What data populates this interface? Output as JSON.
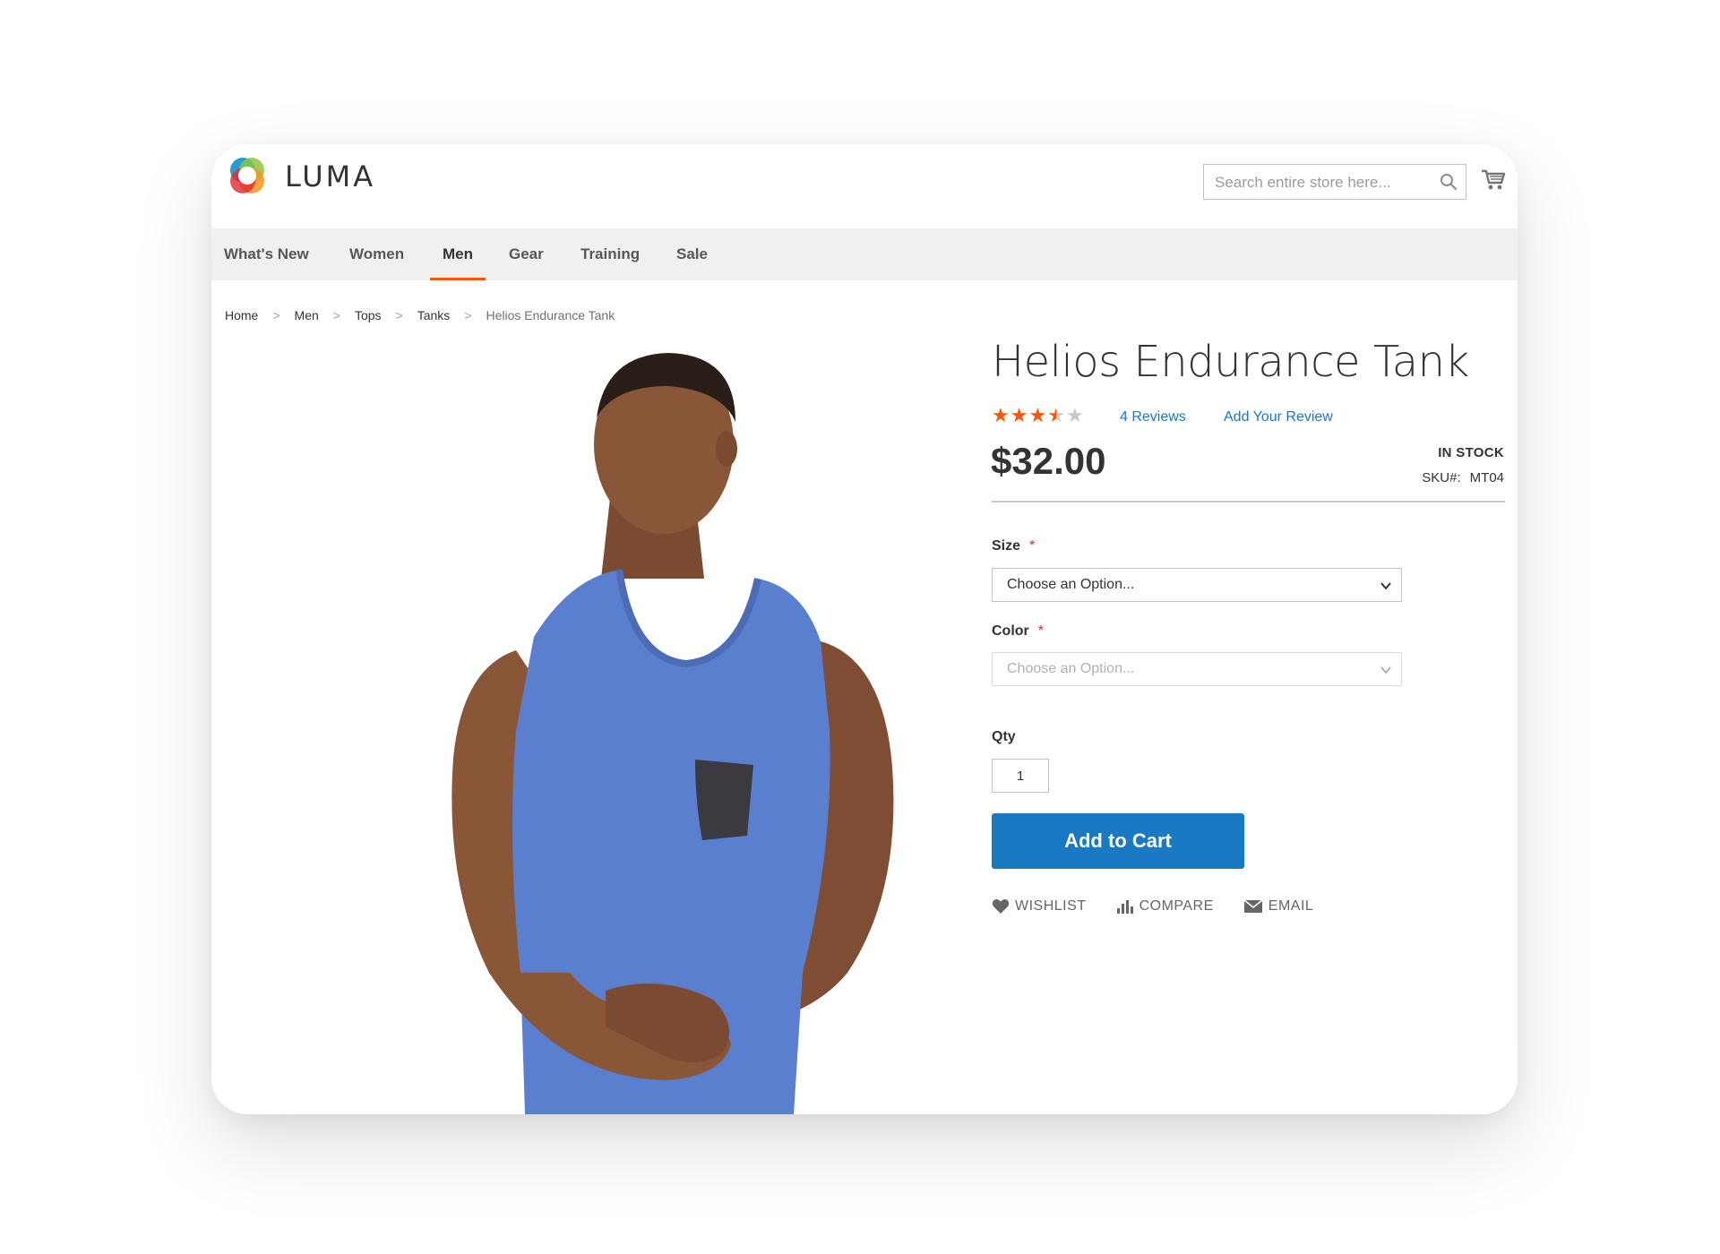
{
  "brand": {
    "name": "LUMA"
  },
  "search": {
    "placeholder": "Search entire store here..."
  },
  "nav": {
    "items": [
      {
        "label": "What's New",
        "active": false
      },
      {
        "label": "Women",
        "active": false
      },
      {
        "label": "Men",
        "active": true
      },
      {
        "label": "Gear",
        "active": false
      },
      {
        "label": "Training",
        "active": false
      },
      {
        "label": "Sale",
        "active": false
      }
    ]
  },
  "breadcrumb": {
    "items": [
      "Home",
      "Men",
      "Tops",
      "Tanks",
      "Helios Endurance Tank"
    ],
    "separator": ">"
  },
  "product": {
    "title": "Helios Endurance Tank",
    "rating": {
      "filled": 3.5,
      "max": 5
    },
    "reviews_link": "4 Reviews",
    "add_review_link": "Add Your Review",
    "price": "$32.00",
    "stock": "IN STOCK",
    "sku_label": "SKU#:",
    "sku": "MT04"
  },
  "options": {
    "size": {
      "label": "Size",
      "required_mark": "*",
      "value": "Choose an Option..."
    },
    "color": {
      "label": "Color",
      "required_mark": "*",
      "value": "Choose an Option..."
    }
  },
  "qty": {
    "label": "Qty",
    "value": "1"
  },
  "add_to_cart": {
    "label": "Add to Cart"
  },
  "actions": {
    "wishlist": "WISHLIST",
    "compare": "COMPARE",
    "email": "EMAIL"
  },
  "colors": {
    "accent": "#1979c3",
    "nav_active_underline": "#ff5501",
    "star_filled": "#ff5501",
    "star_empty": "#c7c7c7",
    "required": "#e02b27",
    "tank_blue": "#5a7fce"
  },
  "icons": [
    "luma-logo-icon",
    "search-icon",
    "cart-icon",
    "star-icon",
    "chevron-down-icon",
    "heart-icon",
    "compare-chart-icon",
    "envelope-icon"
  ]
}
